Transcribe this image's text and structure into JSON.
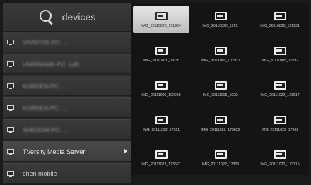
{
  "search": {
    "label": "devices",
    "icon": "search-icon"
  },
  "devices": [
    {
      "name": "VIVISTYE-PC: ...",
      "blurred": true,
      "active": false,
      "has_arrow": false
    },
    {
      "name": "UNIGNAME-PC: (ulf)",
      "blurred": true,
      "active": false,
      "has_arrow": false
    },
    {
      "name": "KORDEN-PC: ...",
      "blurred": true,
      "active": false,
      "has_arrow": false
    },
    {
      "name": "KORDEN-PC: ...",
      "blurred": true,
      "active": false,
      "has_arrow": false
    },
    {
      "name": "SHEDOW-PC: ...",
      "blurred": true,
      "active": false,
      "has_arrow": false
    },
    {
      "name": "TVersity Media Server",
      "blurred": false,
      "active": true,
      "has_arrow": true
    },
    {
      "name": "chen mobile",
      "blurred": false,
      "active": false,
      "has_arrow": false
    }
  ],
  "files": [
    {
      "name": "IMG_20110820_191924",
      "selected": true
    },
    {
      "name": "IMG_20110820_1919:",
      "selected": false
    },
    {
      "name": "IMG_20110820_191931",
      "selected": false
    },
    {
      "name": "IMG_20110820_1919:",
      "selected": false
    },
    {
      "name": "IMG_20111005_102921",
      "selected": false
    },
    {
      "name": "IMG_20111005_10292",
      "selected": false
    },
    {
      "name": "IMG_20111005_102928",
      "selected": false
    },
    {
      "name": "IMG_20111005_1029:",
      "selected": false
    },
    {
      "name": "IMG_20111022_173617",
      "selected": false
    },
    {
      "name": "IMG_20111022_17361",
      "selected": false
    },
    {
      "name": "IMG_20111022_173622",
      "selected": false
    },
    {
      "name": "IMG_20111022_17362",
      "selected": false
    },
    {
      "name": "IMG_20111022_173627",
      "selected": false
    },
    {
      "name": "IMG_20111022_17363",
      "selected": false
    },
    {
      "name": "IMG_20111022_173715",
      "selected": false
    }
  ],
  "colors": {
    "background": "#1a1a1a",
    "selected_tile": "#d8d8d8",
    "text": "#d0d0d0"
  }
}
